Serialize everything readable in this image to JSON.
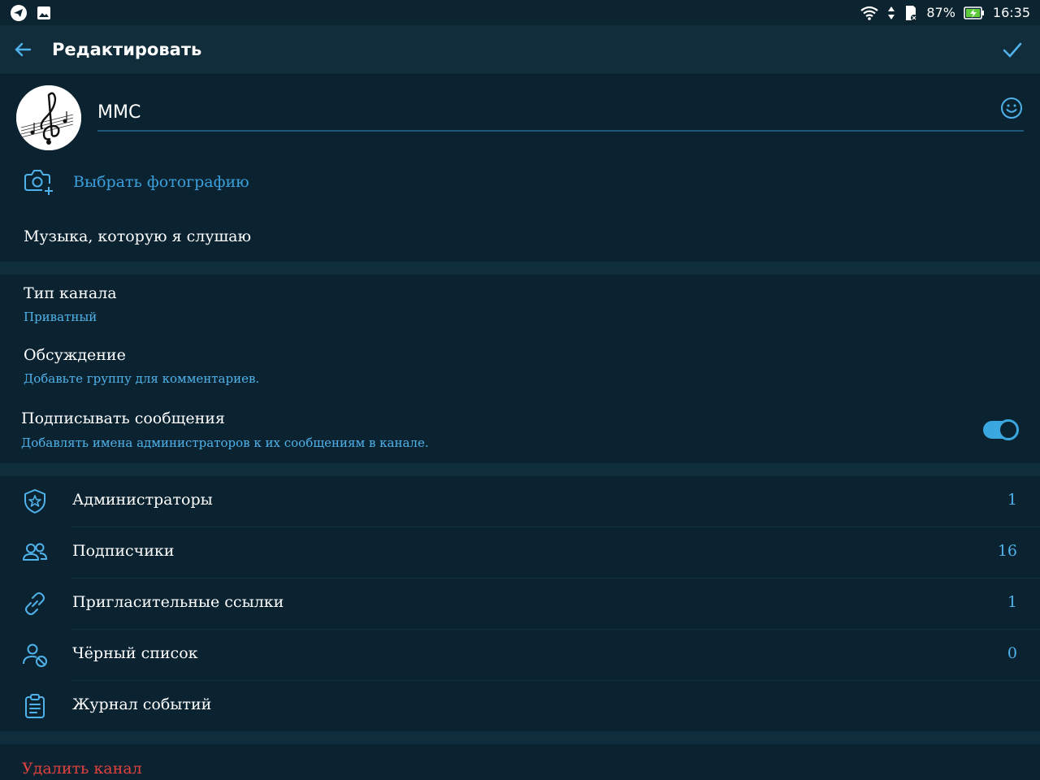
{
  "status_bar": {
    "battery": "87%",
    "time": "16:35"
  },
  "toolbar": {
    "title": "Редактировать"
  },
  "channel": {
    "name": "MMC",
    "choose_photo_label": "Выбрать фотографию",
    "description": "Музыка, которую я слушаю"
  },
  "settings": {
    "channel_type": {
      "title": "Тип канала",
      "value": "Приватный"
    },
    "discussion": {
      "title": "Обсуждение",
      "value": "Добавьте группу для комментариев."
    },
    "sign_messages": {
      "title": "Подписывать сообщения",
      "subtitle": "Добавлять имена администраторов к их сообщениям в канале.",
      "enabled": true
    }
  },
  "list": [
    {
      "label": "Администраторы",
      "count": "1",
      "icon": "admin-shield-icon"
    },
    {
      "label": "Подписчики",
      "count": "16",
      "icon": "subscribers-icon"
    },
    {
      "label": "Пригласительные ссылки",
      "count": "1",
      "icon": "link-icon"
    },
    {
      "label": "Чёрный список",
      "count": "0",
      "icon": "blocked-user-icon"
    },
    {
      "label": "Журнал событий",
      "count": "",
      "icon": "event-log-icon"
    }
  ],
  "delete_label": "Удалить канал",
  "colors": {
    "background": "#0b2330",
    "accent": "#3b9fdc",
    "danger": "#e0413e"
  }
}
